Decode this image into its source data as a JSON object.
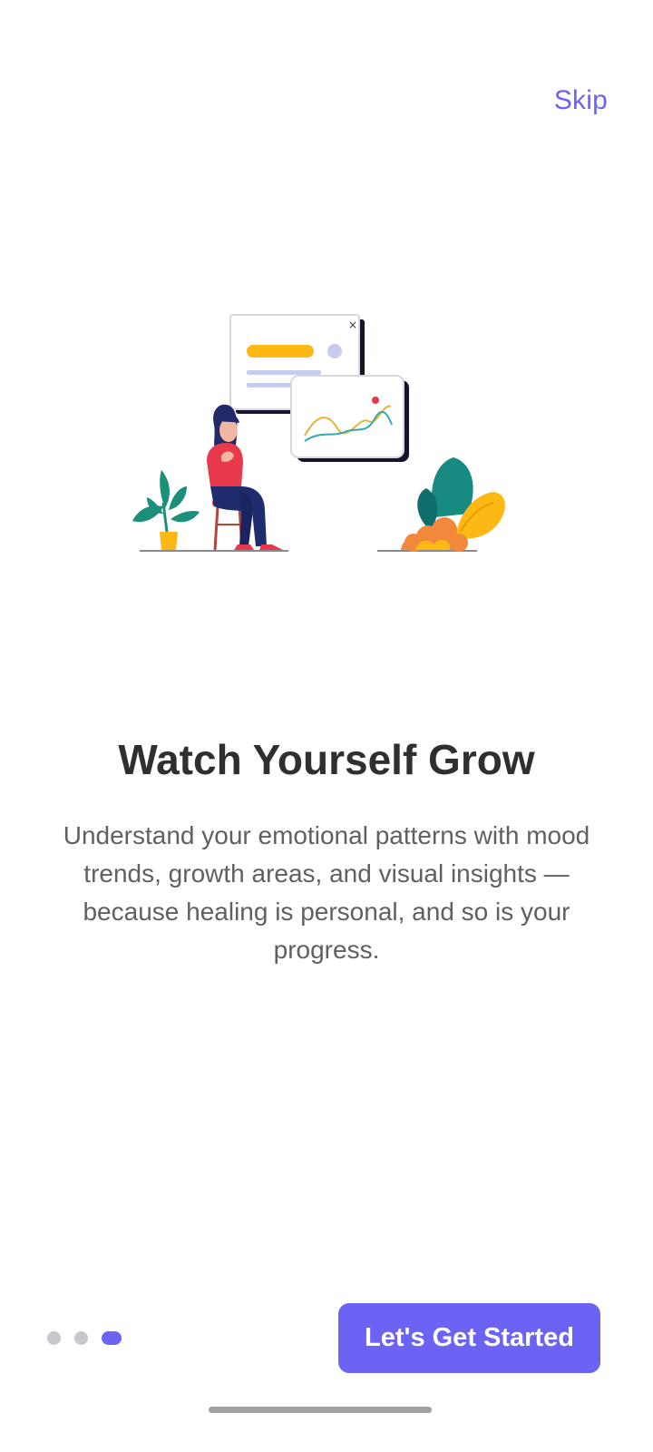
{
  "header": {
    "skip_label": "Skip"
  },
  "illustration": {
    "icon": "person-with-growth-chart-illustration"
  },
  "content": {
    "title": "Watch Yourself Grow",
    "description": "Understand your emotional patterns with mood trends, growth areas, and visual insights — because healing is personal, and so is your progress."
  },
  "pagination": {
    "total": 3,
    "current": 3
  },
  "cta": {
    "label": "Let's Get Started"
  },
  "colors": {
    "accent": "#6C63F5",
    "title": "#2f2f2f",
    "body": "#606060",
    "dot_inactive": "#c8c8cc"
  }
}
